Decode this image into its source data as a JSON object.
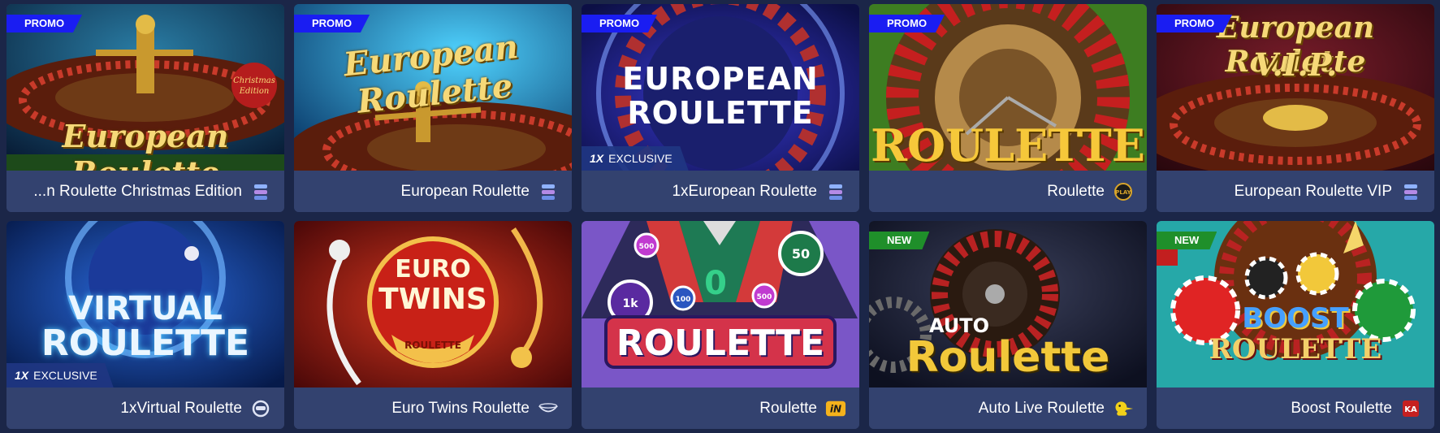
{
  "games": [
    {
      "title": "...n Roulette Christmas Edition",
      "badge": "PROMO",
      "art": "European Roulette",
      "art_sub": "Christmas Edition",
      "provider_icon": "provider-stack-icon"
    },
    {
      "title": "European Roulette",
      "badge": "PROMO",
      "art": "European Roulette",
      "provider_icon": "provider-stack-icon"
    },
    {
      "title": "1xEuropean Roulette",
      "badge": "PROMO",
      "art_line1": "EUROPEAN",
      "art_line2": "ROULETTE",
      "exclusive": "EXCLUSIVE",
      "exclusive_brand": "1X",
      "provider_icon": "provider-stack-icon"
    },
    {
      "title": "Roulette",
      "badge": "PROMO",
      "art": "ROULETTE",
      "provider_icon": "play-medal-icon",
      "provider_text": "PLAY"
    },
    {
      "title": "European Roulette VIP",
      "badge": "PROMO",
      "art": "European Roulette",
      "art_sub": "V.I.P.",
      "provider_icon": "provider-stack-icon"
    },
    {
      "title": "1xVirtual Roulette",
      "art_line1": "VIRTUAL",
      "art_line2": "ROULETTE",
      "exclusive": "EXCLUSIVE",
      "exclusive_brand": "1X",
      "provider_icon": "helmet-icon"
    },
    {
      "title": "Euro Twins Roulette",
      "art_line1": "EURO",
      "art_line2": "TWINS",
      "art_sub": "ROULETTE",
      "provider_icon": "bowl-icon"
    },
    {
      "title": "Roulette",
      "art": "ROULETTE",
      "chip_values": [
        "500",
        "50",
        "1k",
        "100",
        "500"
      ],
      "provider_icon": "in-logo-icon",
      "provider_text": "iN"
    },
    {
      "title": "Auto Live Roulette",
      "badge_new": "NEW",
      "art_line1": "AUTO",
      "art_line2": "Roulette",
      "provider_icon": "duck-icon"
    },
    {
      "title": "Boost Roulette",
      "badge_new": "NEW",
      "art_line1": "BOOST",
      "art_line2": "ROULETTE",
      "provider_icon": "ka-logo-icon",
      "provider_text": "KA"
    }
  ],
  "colors": {
    "background": "#1b2648",
    "caption": "#33426f",
    "promo_badge": "#1a1df2",
    "new_badge": "#1f8f2a",
    "exclusive_bar": "#203682"
  }
}
